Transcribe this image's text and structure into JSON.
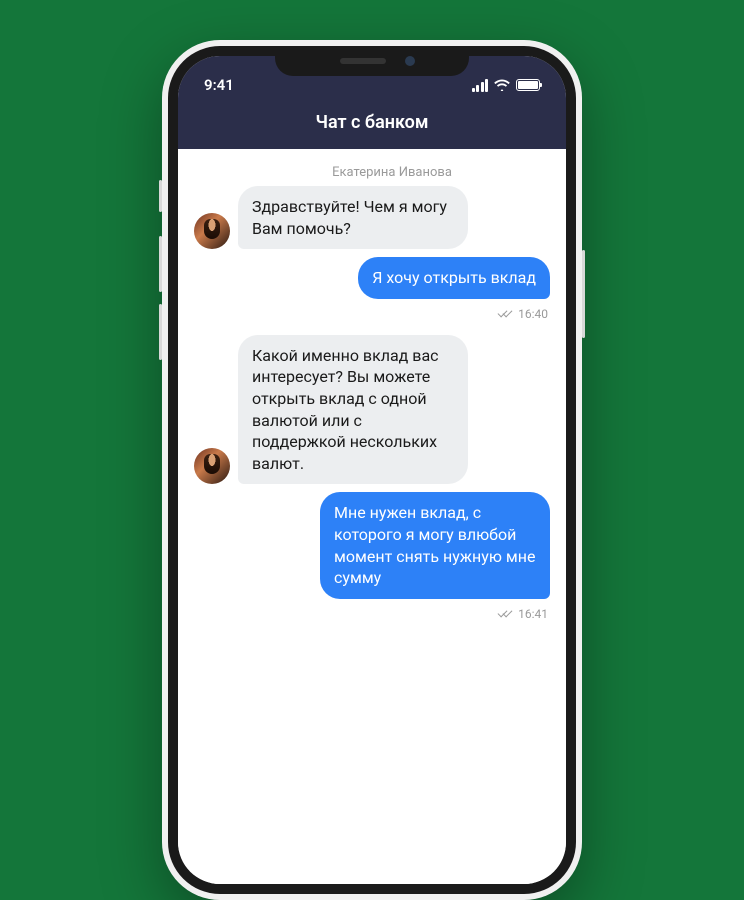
{
  "status": {
    "time": "9:41"
  },
  "header": {
    "title": "Чат с банком"
  },
  "chat": {
    "sender_name": "Екатерина Иванова",
    "messages": [
      {
        "side": "in",
        "text": "Здравствуйте! Чем я могу Вам помочь?"
      },
      {
        "side": "out",
        "text": "Я хочу открыть вклад",
        "time": "16:40"
      },
      {
        "side": "in",
        "text": "Какой именно вклад вас интересует? Вы можете открыть вклад с одной валютой или с поддержкой нескольких валют."
      },
      {
        "side": "out",
        "text": "Мне нужен вклад, с которого я могу влюбой момент снять нужную мне сумму",
        "time": "16:41"
      }
    ]
  }
}
